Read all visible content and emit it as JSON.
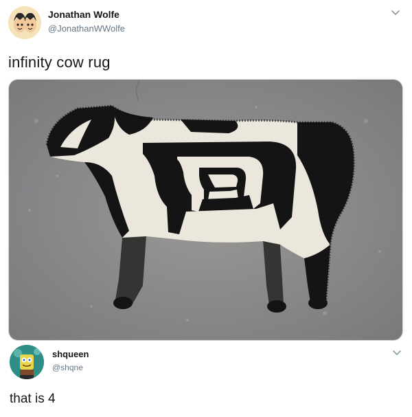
{
  "tweet1": {
    "name": "Jonathan Wolfe",
    "handle": "@JonathanWWolfe",
    "text": "infinity cow rug",
    "media_icon": "photo-cow-rug",
    "menu_icon": "chevron-down-icon"
  },
  "tweet2": {
    "name": "shqueen",
    "handle": "@shqne",
    "text": "that is 4",
    "menu_icon": "chevron-down-icon"
  },
  "colors": {
    "text": "#14171a",
    "secondary": "#657786",
    "floor": "#8a8a88",
    "rug_dark": "#141414",
    "rug_light": "#ece7dc"
  }
}
